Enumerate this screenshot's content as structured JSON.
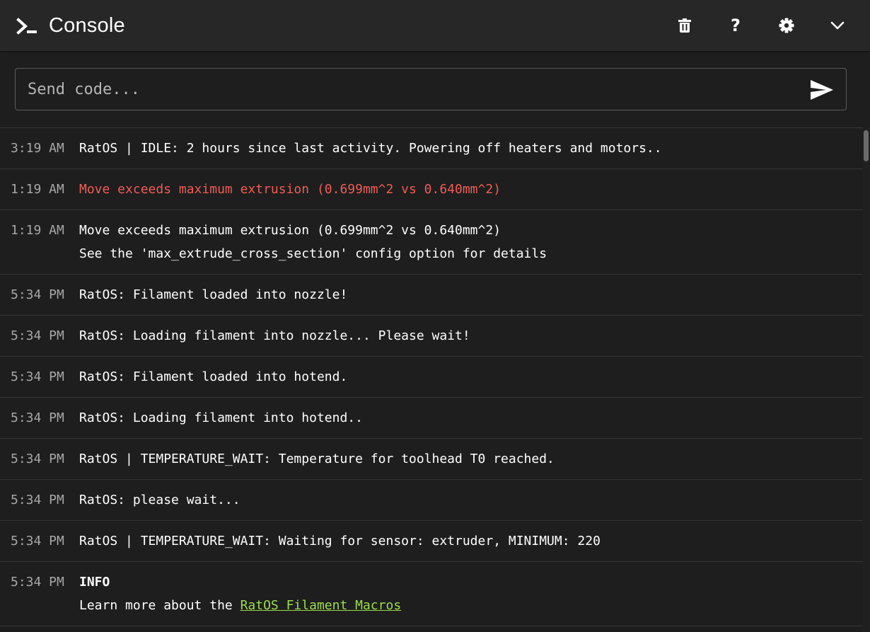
{
  "header": {
    "title": "Console",
    "icons": [
      "console-prompt-icon",
      "trash-icon",
      "help-icon",
      "gear-icon",
      "chevron-down-icon"
    ],
    "help_glyph": "?"
  },
  "input": {
    "placeholder": "Send code...",
    "value": "",
    "send_icon": "send-icon"
  },
  "log": {
    "rows": [
      {
        "time": "3:19 AM",
        "message": "RatOS | IDLE: 2 hours since last activity. Powering off heaters and motors.."
      },
      {
        "time": "1:19 AM",
        "message": "Move exceeds maximum extrusion (0.699mm^2 vs 0.640mm^2)",
        "level": "error"
      },
      {
        "time": "1:19 AM",
        "message": "Move exceeds maximum extrusion (0.699mm^2 vs 0.640mm^2)",
        "message_line2": "See the 'max_extrude_cross_section' config option for details"
      },
      {
        "time": "5:34 PM",
        "message": "RatOS: Filament loaded into nozzle!"
      },
      {
        "time": "5:34 PM",
        "message": "RatOS: Loading filament into nozzle... Please wait!"
      },
      {
        "time": "5:34 PM",
        "message": "RatOS: Filament loaded into hotend."
      },
      {
        "time": "5:34 PM",
        "message": "RatOS: Loading filament into hotend.."
      },
      {
        "time": "5:34 PM",
        "message": "RatOS | TEMPERATURE_WAIT: Temperature for toolhead T0 reached."
      },
      {
        "time": "5:34 PM",
        "message": "RatOS: please wait..."
      },
      {
        "time": "5:34 PM",
        "message": "RatOS | TEMPERATURE_WAIT: Waiting for sensor: extruder, MINIMUM: 220"
      },
      {
        "time": "5:34 PM",
        "message": "INFO",
        "message_line2_prefix": "Learn more about the ",
        "link_text": "RatOS Filament Macros"
      }
    ]
  },
  "colors": {
    "background": "#1e1e1e",
    "header_background": "#272727",
    "timestamp": "#a7a7a7",
    "error_text": "#ef5d55",
    "link": "#9bde49",
    "divider": "#353535"
  }
}
